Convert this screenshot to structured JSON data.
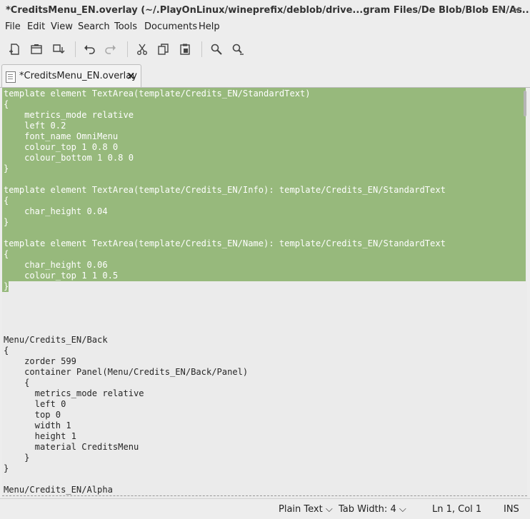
{
  "window": {
    "title": "*CreditsMenu_EN.overlay (~/.PlayOnLinux/wineprefix/deblob/drive...gram Files/De Blob/Blob EN/As...",
    "minimize": "−",
    "maximize": "+",
    "close": "×"
  },
  "menubar": [
    "File",
    "Edit",
    "View",
    "Search",
    "Tools",
    "Documents",
    "Help"
  ],
  "toolbar": {
    "icons": [
      "new-document-icon",
      "open-icon",
      "save-icon",
      "undo-icon",
      "redo-icon",
      "cut-icon",
      "copy-icon",
      "paste-icon",
      "search-icon",
      "search-replace-icon"
    ]
  },
  "tab": {
    "label": "*CreditsMenu_EN.overlay",
    "close": "×"
  },
  "editor": {
    "selected_lines": [
      "template element TextArea(template/Credits_EN/StandardText)",
      "{",
      "    metrics_mode relative",
      "    left 0.2",
      "    font_name OmniMenu",
      "    colour_top 1 0.8 0",
      "    colour_bottom 1 0.8 0",
      "}",
      "",
      "template element TextArea(template/Credits_EN/Info): template/Credits_EN/StandardText",
      "{",
      "    char_height 0.04",
      "}",
      "",
      "template element TextArea(template/Credits_EN/Name): template/Credits_EN/StandardText",
      "{",
      "    char_height 0.06",
      "    colour_top 1 1 0.5",
      "}"
    ],
    "lines": [
      "",
      "",
      "",
      "",
      "Menu/Credits_EN/Back",
      "{",
      "    zorder 599",
      "    container Panel(Menu/Credits_EN/Back/Panel)",
      "    {",
      "      metrics_mode relative",
      "      left 0",
      "      top 0",
      "      width 1",
      "      height 1",
      "      material CreditsMenu",
      "    }",
      "}",
      "",
      "Menu/Credits_EN/Alpha"
    ]
  },
  "statusbar": {
    "language": "Plain Text",
    "tab_width": "Tab Width:",
    "tab_width_value": "4",
    "position": "Ln 1, Col 1",
    "mode": "INS"
  }
}
